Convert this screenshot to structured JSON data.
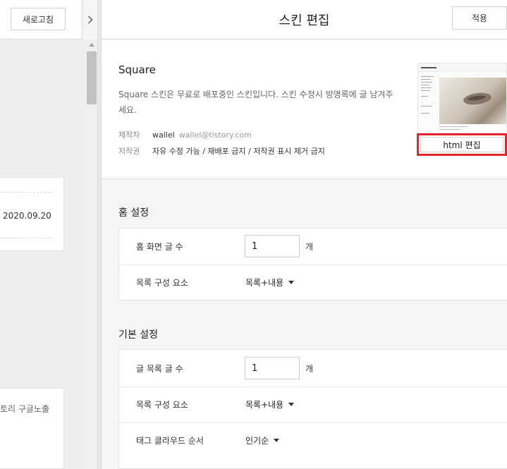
{
  "left_pane": {
    "refresh_label": "새로고침",
    "collapse_icon": "chevron-right-icon",
    "post_date": "2020.09.20",
    "post_snippet": "토리 구글노출"
  },
  "header": {
    "title": "스킨 편집",
    "apply_label": "적용"
  },
  "skin": {
    "name": "Square",
    "description": "Square 스킨은 무료로 배포중인 스킨입니다. 스킨 수정시 방명록에 글 남겨주세요.",
    "author_label": "제작자",
    "author_name": "wallel",
    "author_email": "wallel@tistory.com",
    "license_label": "저작권",
    "license_text": "자유 수정 가능 / 재배포 금지 / 저작권 표시 제거 금지",
    "html_edit_label": "html 편집"
  },
  "home_settings": {
    "title": "홈 설정",
    "post_count_label": "홈 화면 글 수",
    "post_count_value": "1",
    "post_count_unit": "개",
    "list_elements_label": "목록 구성 요소",
    "list_elements_value": "목록+내용"
  },
  "basic_settings": {
    "title": "기본 설정",
    "list_count_label": "글 목록 글 수",
    "list_count_value": "1",
    "list_count_unit": "개",
    "list_elements_label": "목록 구성 요소",
    "list_elements_value": "목록+내용",
    "tag_cloud_label": "태그 클라우드 순서",
    "tag_cloud_value": "인기순"
  }
}
